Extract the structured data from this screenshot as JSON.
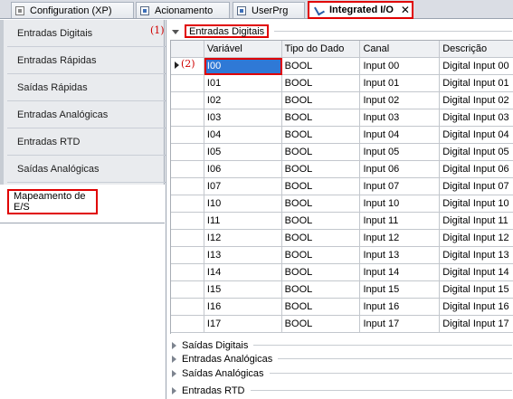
{
  "tabs": [
    {
      "label": "Configuration (XP)",
      "icon": "config-icon"
    },
    {
      "label": "Acionamento",
      "icon": "program-icon"
    },
    {
      "label": "UserPrg",
      "icon": "program-icon"
    },
    {
      "label": "Integrated I/O",
      "icon": "io-config-icon",
      "active": true,
      "close": "✕"
    }
  ],
  "sidebar": {
    "items": [
      {
        "label": "Entradas Digitais"
      },
      {
        "label": "Entradas Rápidas"
      },
      {
        "label": "Saídas Rápidas"
      },
      {
        "label": "Entradas Analógicas"
      },
      {
        "label": "Entradas RTD"
      },
      {
        "label": "Saídas Analógicas"
      }
    ],
    "selected": {
      "label": "Mapeamento de E/S"
    }
  },
  "annotations": {
    "a1": "(1)",
    "a2": "(2)"
  },
  "sections": {
    "open": "Entradas Digitais",
    "collapsed": [
      "Saídas Digitais",
      "Entradas Analógicas",
      "Saídas Analógicas",
      "Entradas RTD"
    ]
  },
  "grid": {
    "columns": [
      "Variável",
      "Tipo do Dado",
      "Canal",
      "Descrição"
    ],
    "rows": [
      {
        "var": "I00",
        "type": "BOOL",
        "canal": "Input 00",
        "desc": "Digital Input 00"
      },
      {
        "var": "I01",
        "type": "BOOL",
        "canal": "Input 01",
        "desc": "Digital Input 01"
      },
      {
        "var": "I02",
        "type": "BOOL",
        "canal": "Input 02",
        "desc": "Digital Input 02"
      },
      {
        "var": "I03",
        "type": "BOOL",
        "canal": "Input 03",
        "desc": "Digital Input 03"
      },
      {
        "var": "I04",
        "type": "BOOL",
        "canal": "Input 04",
        "desc": "Digital Input 04"
      },
      {
        "var": "I05",
        "type": "BOOL",
        "canal": "Input 05",
        "desc": "Digital Input 05"
      },
      {
        "var": "I06",
        "type": "BOOL",
        "canal": "Input 06",
        "desc": "Digital Input 06"
      },
      {
        "var": "I07",
        "type": "BOOL",
        "canal": "Input 07",
        "desc": "Digital Input 07"
      },
      {
        "var": "I10",
        "type": "BOOL",
        "canal": "Input 10",
        "desc": "Digital Input 10"
      },
      {
        "var": "I11",
        "type": "BOOL",
        "canal": "Input 11",
        "desc": "Digital Input 11"
      },
      {
        "var": "I12",
        "type": "BOOL",
        "canal": "Input 12",
        "desc": "Digital Input 12"
      },
      {
        "var": "I13",
        "type": "BOOL",
        "canal": "Input 13",
        "desc": "Digital Input 13"
      },
      {
        "var": "I14",
        "type": "BOOL",
        "canal": "Input 14",
        "desc": "Digital Input 14"
      },
      {
        "var": "I15",
        "type": "BOOL",
        "canal": "Input 15",
        "desc": "Digital Input 15"
      },
      {
        "var": "I16",
        "type": "BOOL",
        "canal": "Input 16",
        "desc": "Digital Input 16"
      },
      {
        "var": "I17",
        "type": "BOOL",
        "canal": "Input 17",
        "desc": "Digital Input 17"
      }
    ]
  },
  "colors": {
    "highlight": "#e00000",
    "selection": "#2f79d6"
  }
}
